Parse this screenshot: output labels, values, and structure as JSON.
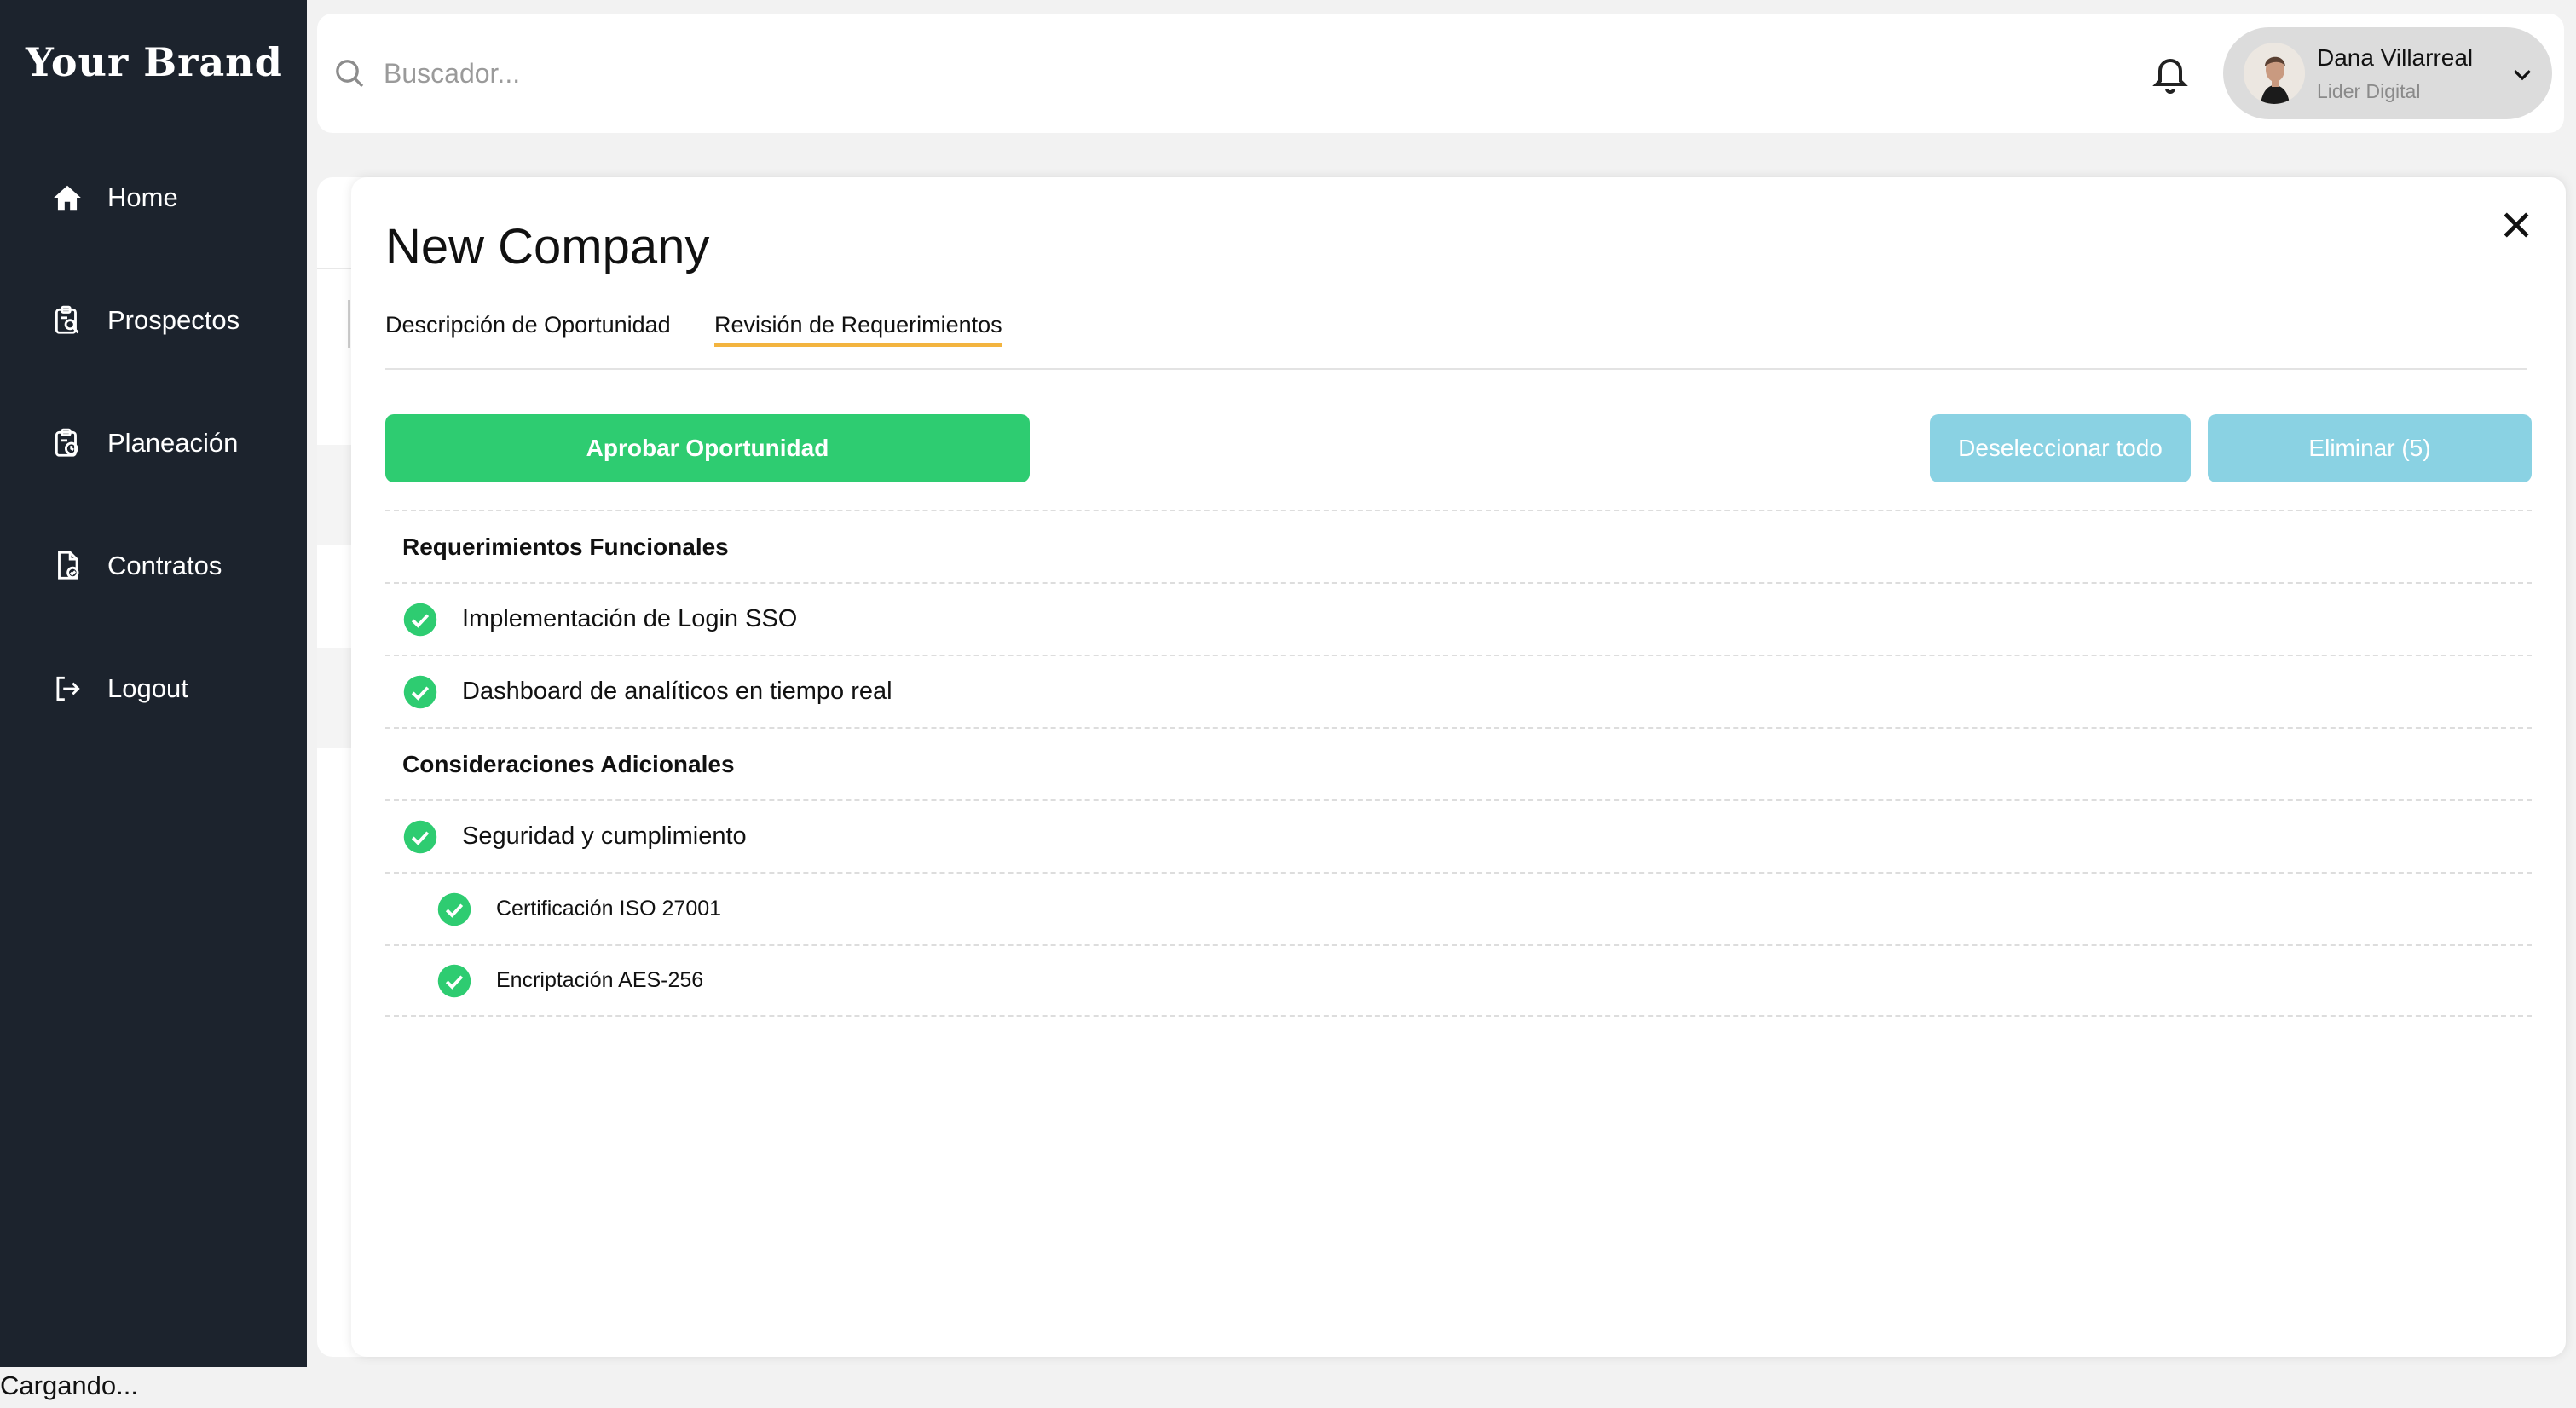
{
  "brand": "Your Brand",
  "sidebar": {
    "items": [
      {
        "label": "Home",
        "icon": "home-icon"
      },
      {
        "label": "Prospectos",
        "icon": "clipboard-search-icon"
      },
      {
        "label": "Planeación",
        "icon": "clipboard-clock-icon"
      },
      {
        "label": "Contratos",
        "icon": "document-check-icon"
      },
      {
        "label": "Logout",
        "icon": "logout-icon"
      }
    ]
  },
  "header": {
    "search_placeholder": "Buscador...",
    "user": {
      "name": "Dana Villarreal",
      "role": "Lider Digital"
    }
  },
  "modal": {
    "title": "New Company",
    "tabs": [
      {
        "label": "Descripción de Oportunidad",
        "active": false
      },
      {
        "label": "Revisión de Requerimientos",
        "active": true
      }
    ],
    "approve_label": "Aprobar Oportunidad",
    "deselect_label": "Deseleccionar todo",
    "delete_label": "Eliminar (5)",
    "sections": [
      {
        "title": "Requerimientos Funcionales",
        "items": [
          {
            "label": "Implementación de Login SSO",
            "level": 0,
            "checked": true
          },
          {
            "label": "Dashboard de analíticos en tiempo real",
            "level": 0,
            "checked": true
          }
        ]
      },
      {
        "title": "Consideraciones Adicionales",
        "items": [
          {
            "label": "Seguridad y cumplimiento",
            "level": 0,
            "checked": true
          },
          {
            "label": "Certificación ISO 27001",
            "level": 1,
            "checked": true
          },
          {
            "label": "Encriptación AES-256",
            "level": 1,
            "checked": true
          }
        ]
      }
    ]
  },
  "status": "Cargando...",
  "colors": {
    "sidebar_bg": "#1c232d",
    "accent_green": "#2ecc71",
    "tab_underline": "#f3b43f",
    "disabled_button": "#8ad2e3"
  }
}
